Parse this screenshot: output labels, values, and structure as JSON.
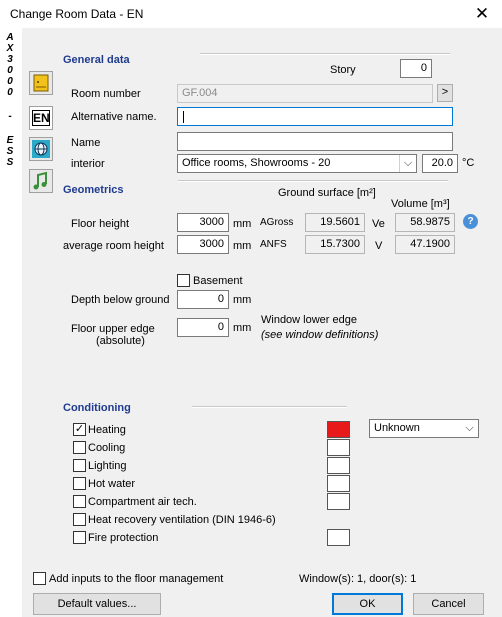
{
  "window": {
    "title": "Change Room Data - EN",
    "close_glyph": "✕"
  },
  "sidebar_letters": [
    "A",
    "X",
    "3",
    "0",
    "0",
    "0",
    "-",
    "E",
    "S",
    "S"
  ],
  "icons": [
    "room-stamp-icon",
    "en-standard-icon",
    "globe-icon",
    "music-note-icon"
  ],
  "en_icon_text": "EN",
  "general": {
    "heading": "General data",
    "story_label": "Story",
    "story_value": "0",
    "room_number_label": "Room number",
    "room_number_value": "GF.004",
    "room_number_btn": ">",
    "alt_name_label": "Alternative name.",
    "alt_name_value": "",
    "name_label": "Name",
    "name_value": "",
    "interior_label": "interior",
    "interior_value": "Office rooms, Showrooms - 20",
    "temp_value": "20.0",
    "temp_unit": "°C"
  },
  "geometrics": {
    "heading": "Geometrics",
    "ground_surface_label": "Ground surface [m²]",
    "volume_label": "Volume [m³]",
    "floor_height_label": "Floor height",
    "floor_height_value": "3000",
    "avg_height_label": "average room height",
    "avg_height_value": "3000",
    "unit_mm": "mm",
    "agross_label": "AGross",
    "agross_value": "19.5601",
    "anfs_label": "ANFS",
    "anfs_value": "15.7300",
    "ve_label": "Ve",
    "ve_value": "58.9875",
    "v_label": "V",
    "v_value": "47.1900",
    "help_glyph": "?",
    "basement_label": "Basement",
    "basement_checked": false,
    "depth_label": "Depth below ground",
    "depth_value": "0",
    "floor_upper_label_1": "Floor upper edge",
    "floor_upper_label_2": "(absolute)",
    "floor_upper_value": "0",
    "window_lower_label": "Window lower edge",
    "window_hint": "(see window definitions)"
  },
  "conditioning": {
    "heading": "Conditioning",
    "items": [
      {
        "label": "Heating",
        "checked": true,
        "color": "#e8191b",
        "has_color": true
      },
      {
        "label": "Cooling",
        "checked": false,
        "color": "#ffffff",
        "has_color": true
      },
      {
        "label": "Lighting",
        "checked": false,
        "color": "#ffffff",
        "has_color": true
      },
      {
        "label": "Hot water",
        "checked": false,
        "color": "#ffffff",
        "has_color": true
      },
      {
        "label": "Compartment air tech.",
        "checked": false,
        "color": "#ffffff",
        "has_color": true
      },
      {
        "label": "Heat recovery ventilation (DIN 1946-6)",
        "checked": false,
        "color": "#ffffff",
        "has_color": false
      },
      {
        "label": "Fire protection",
        "checked": false,
        "color": "#ffffff",
        "has_color": true
      }
    ],
    "heating_type": "Unknown"
  },
  "footer": {
    "add_inputs_label": "Add inputs to the floor management",
    "add_inputs_checked": false,
    "counts_text": "Window(s): 1, door(s): 1",
    "default_btn": "Default values...",
    "ok_btn": "OK",
    "cancel_btn": "Cancel"
  },
  "colors": {
    "section_heading": "#1f3b8f",
    "focus_border": "#0078d7",
    "heating_color": "#e8191b"
  }
}
